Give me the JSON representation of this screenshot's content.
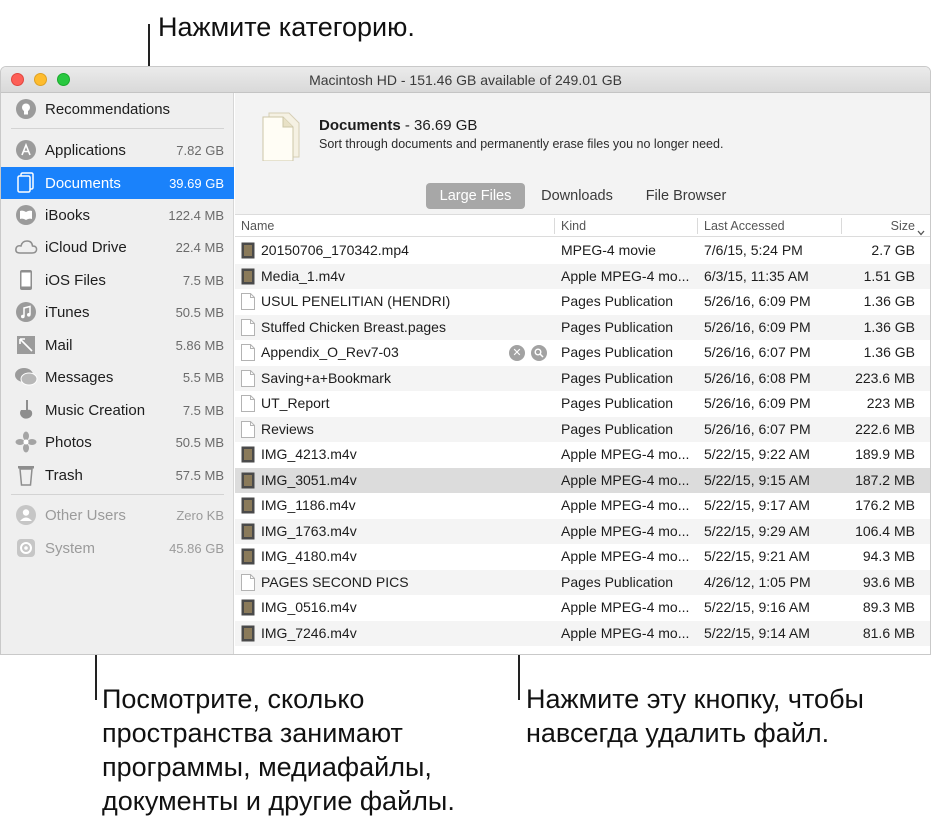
{
  "callouts": {
    "top": "Нажмите категорию.",
    "bottom_left": "Посмотрите, сколько пространства занимают программы, медиафайлы, документы и другие файлы.",
    "bottom_right": "Нажмите эту кнопку, чтобы навсегда удалить файл."
  },
  "window": {
    "title": "Macintosh HD - 151.46 GB available of 249.01 GB"
  },
  "sidebar": {
    "items": [
      {
        "label": "Recommendations",
        "size": "",
        "icon": "lightbulb-icon"
      },
      {
        "label": "Applications",
        "size": "7.82 GB",
        "icon": "app-store-icon"
      },
      {
        "label": "Documents",
        "size": "39.69 GB",
        "icon": "document-icon",
        "selected": true
      },
      {
        "label": "iBooks",
        "size": "122.4 MB",
        "icon": "book-icon"
      },
      {
        "label": "iCloud Drive",
        "size": "22.4 MB",
        "icon": "cloud-icon"
      },
      {
        "label": "iOS Files",
        "size": "7.5 MB",
        "icon": "phone-icon"
      },
      {
        "label": "iTunes",
        "size": "50.5 MB",
        "icon": "music-note-icon"
      },
      {
        "label": "Mail",
        "size": "5.86 MB",
        "icon": "mail-icon"
      },
      {
        "label": "Messages",
        "size": "5.5 MB",
        "icon": "speech-bubble-icon"
      },
      {
        "label": "Music Creation",
        "size": "7.5 MB",
        "icon": "guitar-icon"
      },
      {
        "label": "Photos",
        "size": "50.5 MB",
        "icon": "flower-icon"
      },
      {
        "label": "Trash",
        "size": "57.5 MB",
        "icon": "trash-icon"
      },
      {
        "label": "Other Users",
        "size": "Zero KB",
        "icon": "users-icon",
        "dim": true
      },
      {
        "label": "System",
        "size": "45.86 GB",
        "icon": "gear-icon",
        "dim": true
      }
    ]
  },
  "category": {
    "title": "Documents",
    "size": " - 36.69 GB",
    "description": "Sort through documents and permanently erase files you no longer need."
  },
  "tabs": [
    {
      "label": "Large Files",
      "active": true
    },
    {
      "label": "Downloads",
      "active": false
    },
    {
      "label": "File Browser",
      "active": false
    }
  ],
  "table": {
    "columns": [
      "Name",
      "Kind",
      "Last Accessed",
      "Size"
    ],
    "rows": [
      {
        "name": "20150706_170342.mp4",
        "kind": "MPEG-4 movie",
        "accessed": "7/6/15, 5:24 PM",
        "size": "2.7 GB",
        "icon": "video"
      },
      {
        "name": "Media_1.m4v",
        "kind": "Apple MPEG-4 mo...",
        "accessed": "6/3/15, 11:35 AM",
        "size": "1.51 GB",
        "icon": "video"
      },
      {
        "name": "USUL PENELITIAN (HENDRI)",
        "kind": "Pages Publication",
        "accessed": "5/26/16, 6:09 PM",
        "size": "1.36 GB",
        "icon": "page"
      },
      {
        "name": "Stuffed Chicken Breast.pages",
        "kind": "Pages Publication",
        "accessed": "5/26/16, 6:09 PM",
        "size": "1.36 GB",
        "icon": "page"
      },
      {
        "name": "Appendix_O_Rev7-03",
        "kind": "Pages Publication",
        "accessed": "5/26/16, 6:07 PM",
        "size": "1.36 GB",
        "icon": "page",
        "hover": true
      },
      {
        "name": "Saving+a+Bookmark",
        "kind": "Pages Publication",
        "accessed": "5/26/16, 6:08 PM",
        "size": "223.6 MB",
        "icon": "page"
      },
      {
        "name": "UT_Report",
        "kind": "Pages Publication",
        "accessed": "5/26/16, 6:09 PM",
        "size": "223 MB",
        "icon": "page"
      },
      {
        "name": "Reviews",
        "kind": "Pages Publication",
        "accessed": "5/26/16, 6:07 PM",
        "size": "222.6 MB",
        "icon": "page"
      },
      {
        "name": "IMG_4213.m4v",
        "kind": "Apple MPEG-4 mo...",
        "accessed": "5/22/15, 9:22 AM",
        "size": "189.9 MB",
        "icon": "video"
      },
      {
        "name": "IMG_3051.m4v",
        "kind": "Apple MPEG-4 mo...",
        "accessed": "5/22/15, 9:15 AM",
        "size": "187.2 MB",
        "icon": "video",
        "highlight": true
      },
      {
        "name": "IMG_1186.m4v",
        "kind": "Apple MPEG-4 mo...",
        "accessed": "5/22/15, 9:17 AM",
        "size": "176.2 MB",
        "icon": "video"
      },
      {
        "name": "IMG_1763.m4v",
        "kind": "Apple MPEG-4 mo...",
        "accessed": "5/22/15, 9:29 AM",
        "size": "106.4 MB",
        "icon": "video"
      },
      {
        "name": "IMG_4180.m4v",
        "kind": "Apple MPEG-4 mo...",
        "accessed": "5/22/15, 9:21 AM",
        "size": "94.3 MB",
        "icon": "video"
      },
      {
        "name": "PAGES SECOND PICS",
        "kind": "Pages Publication",
        "accessed": "4/26/12, 1:05 PM",
        "size": "93.6 MB",
        "icon": "page"
      },
      {
        "name": "IMG_0516.m4v",
        "kind": "Apple MPEG-4 mo...",
        "accessed": "5/22/15, 9:16 AM",
        "size": "89.3 MB",
        "icon": "video"
      },
      {
        "name": "IMG_7246.m4v",
        "kind": "Apple MPEG-4 mo...",
        "accessed": "5/22/15, 9:14 AM",
        "size": "81.6 MB",
        "icon": "video"
      }
    ]
  },
  "colors": {
    "accent": "#1a82fb",
    "sidebar": "#efefef",
    "row_alt": "#f4f4f4",
    "row_highlight": "#dcdcdc"
  }
}
